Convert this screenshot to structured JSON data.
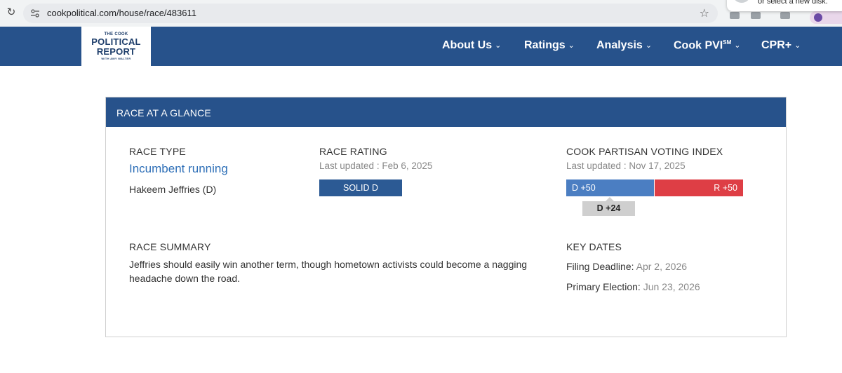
{
  "browser": {
    "url": "cookpolitical.com/house/race/483611",
    "popup_text": "or select a new disk."
  },
  "logo": {
    "line1": "THE COOK",
    "line2": "POLITICAL",
    "line3": "REPORT",
    "line4": "WITH AMY WALTER"
  },
  "nav": {
    "items": [
      {
        "label": "About Us"
      },
      {
        "label": "Ratings"
      },
      {
        "label": "Analysis"
      },
      {
        "label": "Cook PVI"
      },
      {
        "label": "CPR+"
      }
    ],
    "pvi_sup": "SM"
  },
  "card": {
    "title": "RACE AT A GLANCE",
    "race_type": {
      "label": "RACE TYPE",
      "value": "Incumbent running",
      "candidate": "Hakeem Jeffries (D)"
    },
    "race_rating": {
      "label": "RACE RATING",
      "updated": "Last updated : Feb 6, 2025",
      "rating": "SOLID D"
    },
    "pvi": {
      "label": "COOK PARTISAN VOTING INDEX",
      "updated": "Last updated : Nov 17, 2025",
      "left": "D +50",
      "right": "R +50",
      "marker": "D +24"
    },
    "summary": {
      "label": "RACE SUMMARY",
      "text": "Jeffries should easily win another term, though hometown activists could become a nagging headache down the road."
    },
    "key_dates": {
      "label": "KEY DATES",
      "filing_label": "Filing Deadline:",
      "filing_value": "Apr 2, 2026",
      "primary_label": "Primary Election:",
      "primary_value": "Jun 23, 2026"
    }
  },
  "colors": {
    "brand_blue": "#27528b",
    "democrat": "#4b7ec2",
    "republican": "#de3e45"
  }
}
